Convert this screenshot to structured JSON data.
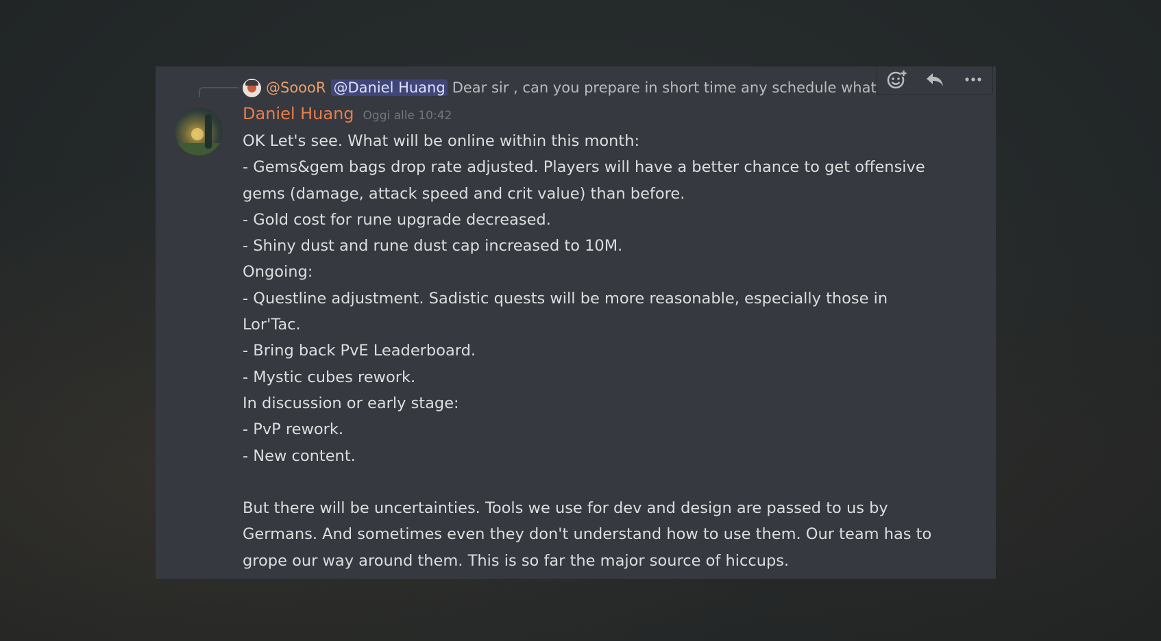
{
  "reply": {
    "author": "@SoooR",
    "mention": "@Daniel Huang",
    "text": "Dear sir , can you prepare in short time any schedule what will"
  },
  "toolbar": {
    "icons": [
      "add-reaction-icon",
      "reply-icon",
      "more-options-icon"
    ]
  },
  "message": {
    "author": "Daniel Huang",
    "timestamp": "Oggi alle 10:42",
    "lines": [
      "OK Let's see. What will be online within this month:",
      "- Gems&gem bags drop rate adjusted. Players will have a better chance to get offensive",
      "gems (damage, attack speed and crit value) than before.",
      "- Gold cost for rune upgrade decreased.",
      "- Shiny dust and rune dust cap increased to 10M.",
      "Ongoing:",
      "- Questline adjustment. Sadistic quests will be more reasonable, especially those in",
      "Lor'Tac.",
      "- Bring back PvE Leaderboard.",
      "- Mystic cubes rework.",
      "In discussion or early stage:",
      "- PvP rework.",
      "- New content.",
      "",
      "But there will be uncertainties. Tools we use for dev and design are passed to us by",
      "Germans. And sometimes even they don't understand how to use them. Our team has to",
      "grope our way around them. This is so far the major source of hiccups."
    ]
  },
  "colors": {
    "panel": "#36393f",
    "username": "#e67e4d",
    "text": "#dcddde",
    "mention_bg": "#4a4f8a"
  }
}
